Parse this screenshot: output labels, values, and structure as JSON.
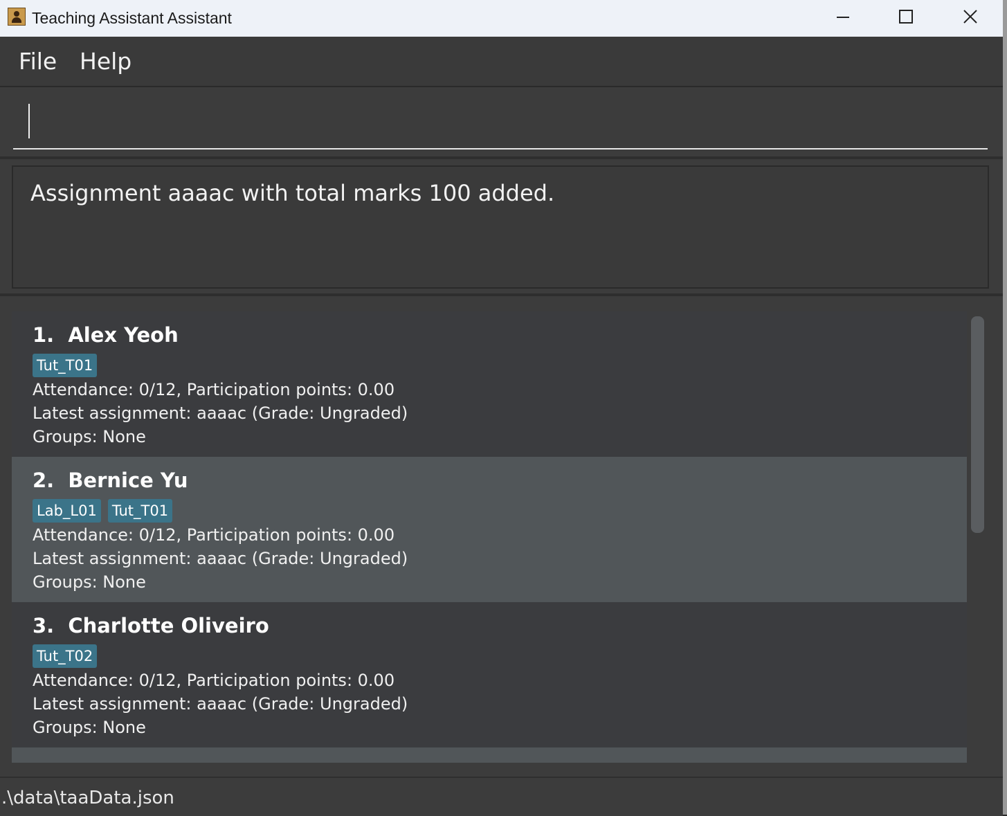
{
  "window": {
    "title": "Teaching Assistant Assistant"
  },
  "menu": {
    "file_label": "File",
    "help_label": "Help"
  },
  "command": {
    "value": ""
  },
  "result": {
    "message": "Assignment aaaac with total marks 100 added."
  },
  "people": [
    {
      "index": "1.",
      "name": "Alex Yeoh",
      "tags": [
        "Tut_T01"
      ],
      "attendance": "Attendance: 0/12, Participation points: 0.00",
      "assignment": "Latest assignment: aaaac (Grade: Ungraded)",
      "groups": "Groups: None",
      "selected": false
    },
    {
      "index": "2.",
      "name": "Bernice Yu",
      "tags": [
        "Lab_L01",
        "Tut_T01"
      ],
      "attendance": "Attendance: 0/12, Participation points: 0.00",
      "assignment": "Latest assignment: aaaac (Grade: Ungraded)",
      "groups": "Groups: None",
      "selected": true
    },
    {
      "index": "3.",
      "name": "Charlotte Oliveiro",
      "tags": [
        "Tut_T02"
      ],
      "attendance": "Attendance: 0/12, Participation points: 0.00",
      "assignment": "Latest assignment: aaaac (Grade: Ungraded)",
      "groups": "Groups: None",
      "selected": false
    }
  ],
  "status": {
    "path": ".\\data\\taaData.json"
  },
  "colors": {
    "tag_background": "#3b7489",
    "selected_card": "#515659",
    "card": "#3b3c3f"
  }
}
